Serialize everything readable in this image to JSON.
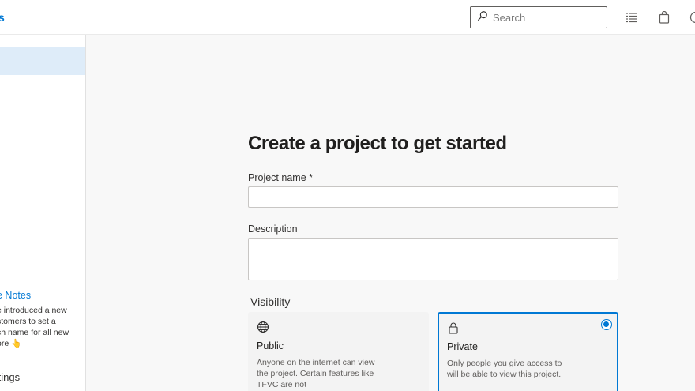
{
  "header": {
    "brand_fragment": "s",
    "search": {
      "placeholder": "Search"
    },
    "icons": [
      "search-icon",
      "task-list-icon",
      "shopping-bag-icon",
      "help-icon"
    ]
  },
  "sidebar": {
    "release_notes": {
      "title": "e Notes",
      "lines": [
        "e introduced a new",
        "stomers to set a",
        "ch name for all new",
        "ore 👆"
      ]
    },
    "settings_label": "ttings"
  },
  "form": {
    "title": "Create a project to get started",
    "project_name_label": "Project name *",
    "project_name_value": "",
    "description_label": "Description",
    "description_value": "",
    "visibility_label": "Visibility",
    "options": [
      {
        "title": "Public",
        "description": "Anyone on the internet can view the project. Certain features like TFVC are not",
        "icon": "globe-icon",
        "selected": false
      },
      {
        "title": "Private",
        "description": "Only people you give access to will be able to view this project.",
        "icon": "lock-icon",
        "selected": true
      }
    ]
  },
  "colors": {
    "accent": "#0078d4",
    "selected_bg": "#deecf9",
    "page_bg": "#f8f8f8"
  }
}
